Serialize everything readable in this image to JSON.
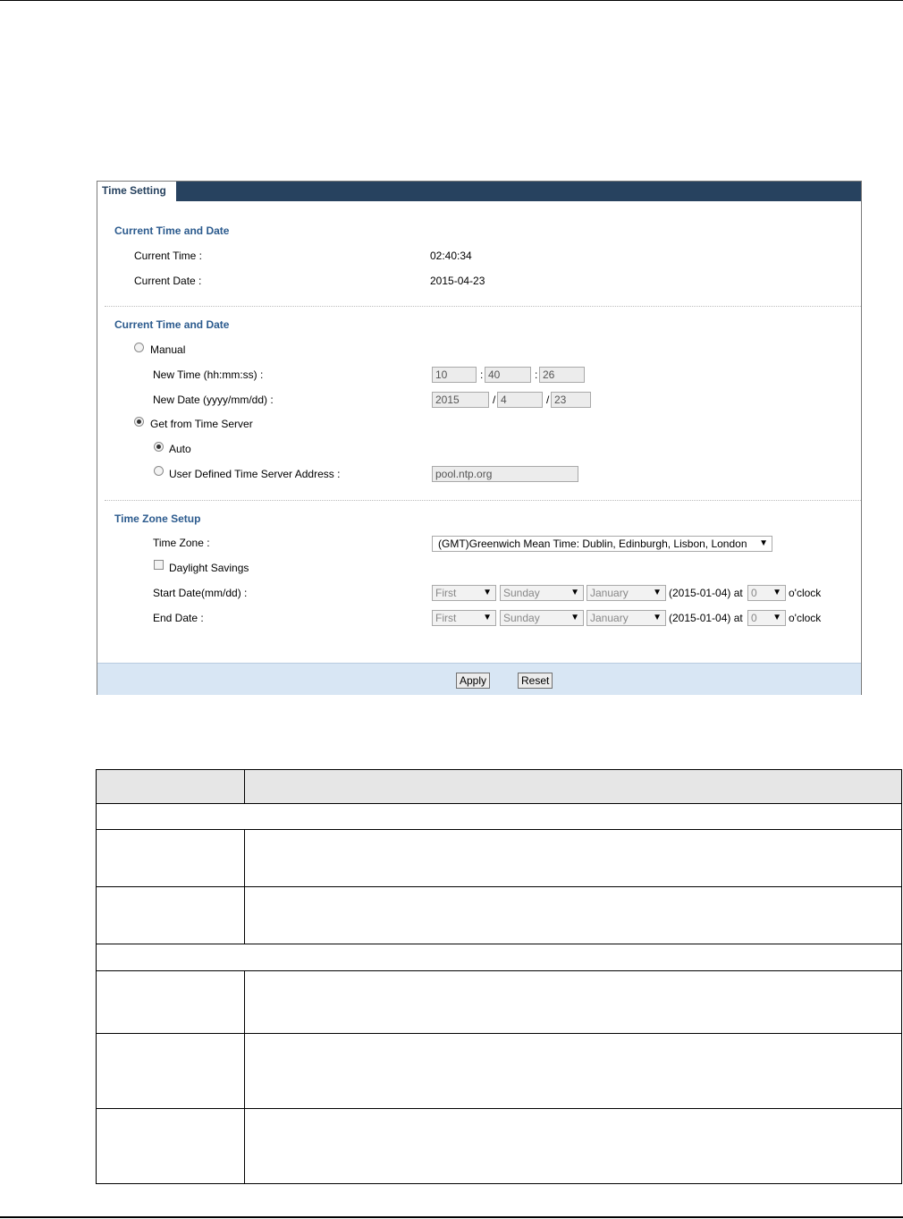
{
  "tab": {
    "title": "Time Setting"
  },
  "current": {
    "title": "Current Time and Date",
    "time_label": "Current Time :",
    "time_value": "02:40:34",
    "date_label": "Current Date :",
    "date_value": "2015-04-23"
  },
  "setting": {
    "title": "Current Time and Date",
    "manual_label": "Manual",
    "new_time_label": "New Time (hh:mm:ss) :",
    "hh": "10",
    "mm": "40",
    "ss": "26",
    "time_sep": ":",
    "new_date_label": "New Date (yyyy/mm/dd) :",
    "yyyy": "2015",
    "month": "4",
    "day": "23",
    "date_sep": "/",
    "server_label": "Get from Time Server",
    "auto_label": "Auto",
    "user_defined_label": "User Defined Time Server Address :",
    "server_address": "pool.ntp.org"
  },
  "timezone": {
    "title": "Time Zone Setup",
    "zone_label": "Time Zone :",
    "zone_value": "(GMT)Greenwich Mean Time: Dublin, Edinburgh, Lisbon, London",
    "daylight_label": "Daylight Savings",
    "start_label": "Start Date(mm/dd) :",
    "end_label": "End Date :",
    "start": {
      "week": "First",
      "day": "Sunday",
      "month": "January",
      "date": "(2015-01-04) at",
      "hour": "0",
      "suffix": "o'clock"
    },
    "end": {
      "week": "First",
      "day": "Sunday",
      "month": "January",
      "date": "(2015-01-04) at",
      "hour": "0",
      "suffix": "o'clock"
    }
  },
  "buttons": {
    "apply": "Apply",
    "reset": "Reset"
  },
  "icons": {
    "dropdown": "chevron-down-icon",
    "radio": "radio-icon",
    "checkbox": "checkbox-icon"
  }
}
